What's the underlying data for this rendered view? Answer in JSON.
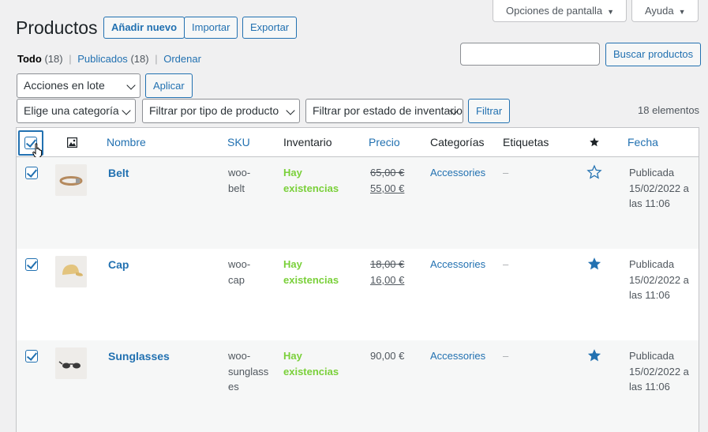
{
  "page": {
    "title": "Productos",
    "add_new": "Añadir nuevo",
    "import": "Importar",
    "export": "Exportar"
  },
  "screen_tabs": {
    "options": "Opciones de pantalla",
    "help": "Ayuda"
  },
  "views": {
    "all_label": "Todo",
    "all_count": "(18)",
    "published_label": "Publicados",
    "published_count": "(18)",
    "sort_label": "Ordenar"
  },
  "search": {
    "value": "",
    "button": "Buscar productos"
  },
  "bulk": {
    "selected": "Acciones en lote",
    "apply": "Aplicar"
  },
  "filters": {
    "category": "Elige una categoría",
    "product_type": "Filtrar por tipo de producto",
    "stock_status": "Filtrar por estado de inventario",
    "button": "Filtrar",
    "item_count": "18 elementos"
  },
  "columns": {
    "name": "Nombre",
    "sku": "SKU",
    "stock": "Inventario",
    "price": "Precio",
    "categories": "Categorías",
    "tags": "Etiquetas",
    "date": "Fecha"
  },
  "rows": [
    {
      "name": "Belt",
      "sku_1": "woo-",
      "sku_2": "belt",
      "stock_1": "Hay",
      "stock_2": "existencias",
      "regular_price": "65,00 €",
      "sale_price": "55,00 €",
      "category": "Accessories",
      "tags": "–",
      "featured": false,
      "date_status": "Publicada",
      "date_day": "15/02/2022 a",
      "date_time": "las 11:06"
    },
    {
      "name": "Cap",
      "sku_1": "woo-",
      "sku_2": "cap",
      "stock_1": "Hay",
      "stock_2": "existencias",
      "regular_price": "18,00 €",
      "sale_price": "16,00 €",
      "category": "Accessories",
      "tags": "–",
      "featured": true,
      "date_status": "Publicada",
      "date_day": "15/02/2022 a",
      "date_time": "las 11:06"
    },
    {
      "name": "Sunglasses",
      "sku_1": "woo-",
      "sku_2": "sunglass",
      "sku_3": "es",
      "stock_1": "Hay",
      "stock_2": "existencias",
      "price": "90,00 €",
      "category": "Accessories",
      "tags": "–",
      "featured": true,
      "date_status": "Publicada",
      "date_day": "15/02/2022 a",
      "date_time": "las 11:06"
    }
  ],
  "colors": {
    "link": "#2271b1",
    "in_stock": "#7ad03a",
    "background": "#f0f0f1"
  }
}
